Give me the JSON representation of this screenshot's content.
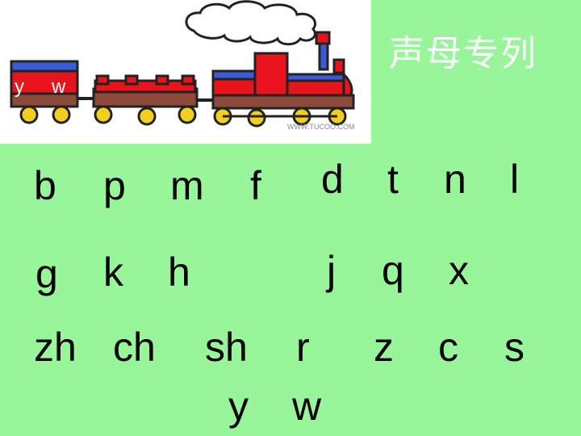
{
  "title": "声母专列",
  "train": {
    "car_letters": [
      "y",
      "w"
    ],
    "watermark": "WWW.TUCOO.COM"
  },
  "initials": {
    "row1": [
      "b",
      "p",
      "m",
      "f",
      "d",
      "t",
      "n",
      "l"
    ],
    "row2": [
      "g",
      "k",
      "h",
      "j",
      "q",
      "x"
    ],
    "row3": [
      "zh",
      "ch",
      "sh",
      "r",
      "z",
      "c",
      "s"
    ],
    "row4": [
      "y",
      "w"
    ]
  },
  "colors": {
    "background": "#98f59a",
    "train_red": "#e8131b",
    "train_brown": "#8b4a3a",
    "train_blue": "#3b5bd6",
    "wheel_yellow": "#f2cf1c"
  }
}
